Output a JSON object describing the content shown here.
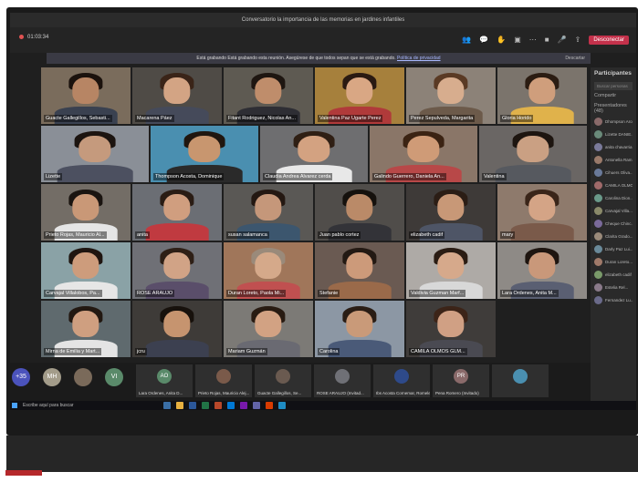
{
  "window": {
    "title": "Conversatorio la importancia de las memorias en jardines infantiles"
  },
  "topbar": {
    "timer": "01:03:34",
    "leave_label": "Desconectar"
  },
  "recording": {
    "message": "Está grabando  Está grabando esta reunión. Asegúrese de que todos sepan que se está grabando.",
    "link": "Política de privacidad",
    "dismiss": "Descartar"
  },
  "participants": [
    {
      "name": "Guacte Gallegillos, Sebasti...",
      "face": "#b78564",
      "hair": "#1b120d",
      "shirt": "#3a4150",
      "bg": "#7a6c5c"
    },
    {
      "name": "Macarena Páez",
      "face": "#d3a484",
      "hair": "#3a2418",
      "shirt": "#454a5a",
      "bg": "#4f4b46"
    },
    {
      "name": "Fitant Rodriguez, Nicolas An...",
      "face": "#bf8d6b",
      "hair": "#1e1611",
      "shirt": "#2e2e34",
      "bg": "#5e5a52"
    },
    {
      "name": "Valentina Paz Ugarte Perez",
      "face": "#d9a784",
      "hair": "#2a1a12",
      "shirt": "#b03a3a",
      "bg": "#a6803c"
    },
    {
      "name": "Perez Sepulveda, Margarita",
      "face": "#d7ad8e",
      "hair": "#5a3a24",
      "shirt": "#6c5a4a",
      "bg": "#8c8278"
    },
    {
      "name": "Gloria Horido",
      "face": "#cf9e7c",
      "hair": "#2b1c12",
      "shirt": "#e0b24b",
      "bg": "#7b746c"
    },
    {
      "name": "Lizette",
      "face": "#c59a7d",
      "hair": "#1c1410",
      "shirt": "#4c5060",
      "bg": "#8a8f97"
    },
    {
      "name": "Thompson Acosta, Dominique",
      "face": "#c8966f",
      "hair": "#20160f",
      "shirt": "#2a2a2a",
      "bg": "#4a8fb0"
    },
    {
      "name": "Claudia Andrea Alvarez cerda",
      "face": "#d3a281",
      "hair": "#2f1f14",
      "shirt": "#e8e8e8",
      "bg": "#6e6e70"
    },
    {
      "name": "Galindo Guerrero, Daniela An...",
      "face": "#cf9b77",
      "hair": "#3b2313",
      "shirt": "#b84848",
      "bg": "#8a7668"
    },
    {
      "name": "Valentina",
      "face": "#caa083",
      "hair": "#1d1510",
      "shirt": "#56595f",
      "bg": "#6a6664"
    },
    {
      "name": "Prieto Rojas, Mauricio Al...",
      "face": "#c99877",
      "hair": "#1a1410",
      "shirt": "#e5e5e5",
      "bg": "#736d66"
    },
    {
      "name": "anita",
      "face": "#d09e7f",
      "hair": "#2a1c14",
      "shirt": "#c03a40",
      "bg": "#6b6e74"
    },
    {
      "name": "susan salamanca",
      "face": "#c5977a",
      "hair": "#241812",
      "shirt": "#3c566e",
      "bg": "#5a5855"
    },
    {
      "name": "Juan pablo cortez",
      "face": "#ba8a68",
      "hair": "#15110d",
      "shirt": "#333338",
      "bg": "#504d4a"
    },
    {
      "name": "elizabeth cadif",
      "face": "#c89877",
      "hair": "#2b1d15",
      "shirt": "#4e5566",
      "bg": "#3e3a38"
    },
    {
      "name": "mary",
      "face": "#d4a486",
      "hair": "#3a2519",
      "shirt": "#7a5a4a",
      "bg": "#8e7a6c"
    },
    {
      "name": "Carvajal Villalobos, Pa...",
      "face": "#cd9c7c",
      "hair": "#1f1510",
      "shirt": "#e6e6e6",
      "bg": "#8aa2a6"
    },
    {
      "name": "ROSE ARAUJO",
      "face": "#d1a386",
      "hair": "#2e1f16",
      "shirt": "#5a4e6a",
      "bg": "#6f7076"
    },
    {
      "name": "Duran Loreto, Paola Mi...",
      "face": "#d5a98a",
      "hair": "#9a8a7a",
      "shirt": "#c05050",
      "bg": "#a0765a"
    },
    {
      "name": "Stefanie",
      "face": "#cc9a7a",
      "hair": "#231913",
      "shirt": "#9a6a4a",
      "bg": "#6a5a52"
    },
    {
      "name": "Valdivia Guzman Marf...",
      "face": "#d6a98b",
      "hair": "#2a1c13",
      "shirt": "#d8d8d8",
      "bg": "#aeaaa6"
    },
    {
      "name": "Lara Ordenes, Anita M...",
      "face": "#c9987a",
      "hair": "#1e1510",
      "shirt": "#5a5f72",
      "bg": "#8e8a86"
    },
    {
      "name": "Mirna de Emilia y Mart...",
      "face": "#cf9f80",
      "hair": "#221811",
      "shirt": "#e4e4e4",
      "bg": "#5f6a6e"
    },
    {
      "name": "jcru",
      "face": "#c6946f",
      "hair": "#17110c",
      "shirt": "#3c4050",
      "bg": "#3e3b38"
    },
    {
      "name": "Mariam Guzmán",
      "face": "#d2a283",
      "hair": "#281b12",
      "shirt": "#6a6a72",
      "bg": "#7c7a76"
    },
    {
      "name": "Carolina",
      "face": "#c99a79",
      "hair": "#2a1d15",
      "shirt": "#4a5a78",
      "bg": "#8c97a4"
    },
    {
      "name": "CAMILA OLMOS GLM...",
      "face": "#d0a084",
      "hair": "#3c2418",
      "shirt": "#4a4a52",
      "bg": "#3f3c3a"
    }
  ],
  "bottom_strip": {
    "more_count": "+35",
    "avatars": [
      {
        "initials": "MH",
        "color": "#a39c8a"
      },
      {
        "initials": "",
        "color": "#7a6a5a"
      },
      {
        "initials": "VI",
        "color": "#5a8a6a"
      }
    ],
    "thumbs": [
      {
        "initials": "AO",
        "name": "Lara Ordenes, Anita D...",
        "color": "#5a8a6a"
      },
      {
        "initials": "",
        "name": "Prieto Rojas, Mauricio Alej...",
        "color": "#7a5a4a"
      },
      {
        "initials": "",
        "name": "Guacte Gallegillos, Se...",
        "color": "#6a5a50"
      },
      {
        "initials": "",
        "name": "ROSE ARAUJO (Invitad...",
        "color": "#6f7076"
      },
      {
        "initials": "",
        "name": "Ibs Acosta Cornemar, Romele",
        "color": "#2e4a8a"
      },
      {
        "initials": "PR",
        "name": "Pena Romero (Invitado)",
        "color": "#8a6a6a"
      },
      {
        "initials": "",
        "name": "",
        "color": "#4a8fb0"
      }
    ]
  },
  "panel": {
    "title": "Participantes",
    "search_placeholder": "Buscar personas",
    "share": "Compartir",
    "section": "Presentadores (48)",
    "people": [
      {
        "name": "Dhompson Aro...",
        "color": "#8a6a6a"
      },
      {
        "name": "Lizette DANIE...",
        "color": "#6a8a7a"
      },
      {
        "name": "anita chavarria",
        "color": "#7a7a9a"
      },
      {
        "name": "Antonella Ram...",
        "color": "#9a7a6a"
      },
      {
        "name": "Cihuers Oliva...",
        "color": "#6a7a9a"
      },
      {
        "name": "CAMILA OLMOS",
        "color": "#a06a6a"
      },
      {
        "name": "Carolina Dion...",
        "color": "#6a9a8a"
      },
      {
        "name": "Carvajal Villa...",
        "color": "#8a8a6a"
      },
      {
        "name": "Cheque Chinc...",
        "color": "#7a6a9a"
      },
      {
        "name": "Clarita Grado...",
        "color": "#9a8a7a"
      },
      {
        "name": "Darly Paz Lui...",
        "color": "#6a8a9a"
      },
      {
        "name": "Duran Loreto...",
        "color": "#a07a6a"
      },
      {
        "name": "elizabeth cadif",
        "color": "#7a9a6a"
      },
      {
        "name": "Estelia Rel...",
        "color": "#8a7a8a"
      },
      {
        "name": "Fernandez Lu...",
        "color": "#6a6a8a"
      }
    ]
  },
  "taskbar": {
    "search": "Escribe aquí para buscar"
  }
}
